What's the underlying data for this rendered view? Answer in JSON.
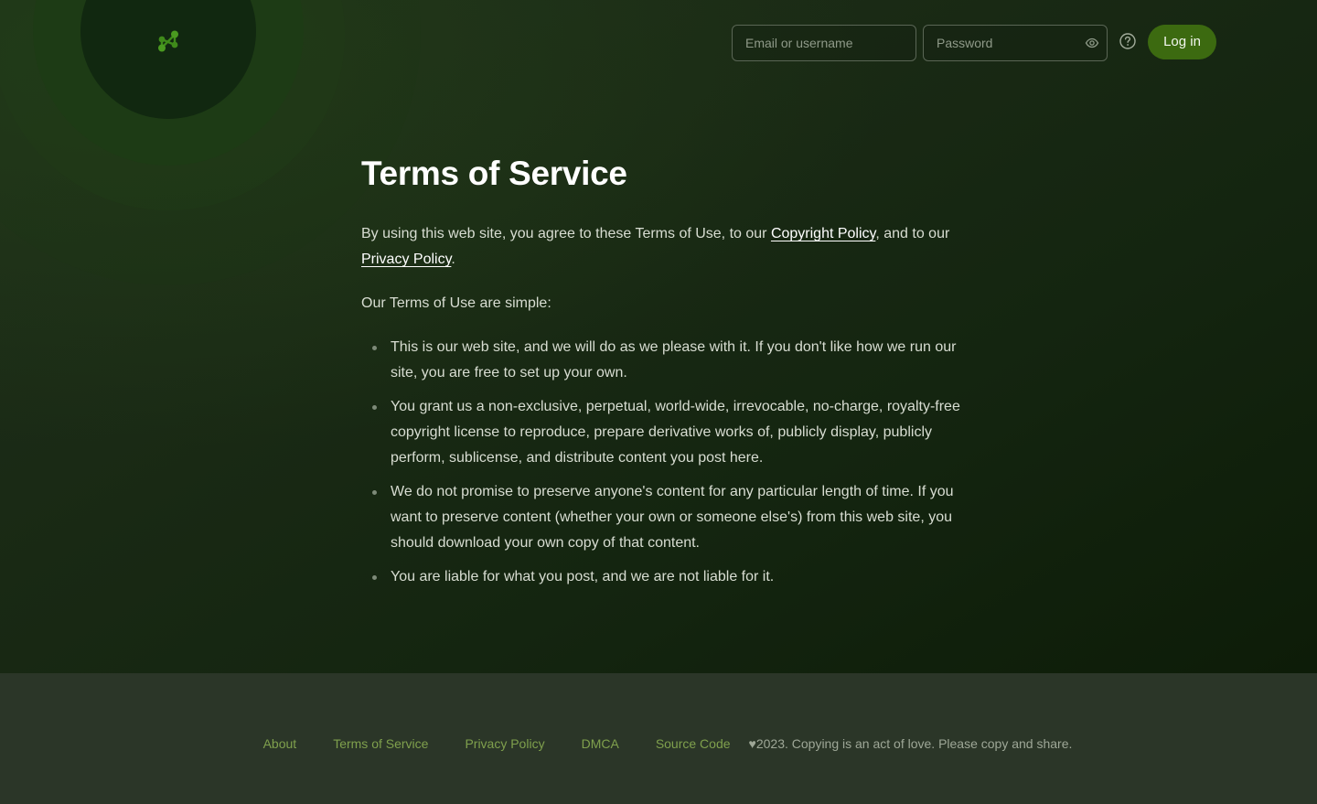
{
  "header": {
    "logo_icon": "network-nodes-icon",
    "email_placeholder": "Email or username",
    "password_placeholder": "Password",
    "show_password_icon": "eye-icon",
    "help_icon": "question-circle-icon",
    "login_label": "Log in"
  },
  "main": {
    "title": "Terms of Service",
    "intro": {
      "before_copyright": "By using this web site, you agree to these Terms of Use, to our ",
      "copyright_link": "Copyright Policy",
      "between": ", and to our ",
      "privacy_link": "Privacy Policy",
      "after": "."
    },
    "simple_line": "Our Terms of Use are simple:",
    "terms": [
      "This is our web site, and we will do as we please with it. If you don't like how we run our site, you are free to set up your own.",
      "You grant us a non-exclusive, perpetual, world-wide, irrevocable, no-charge, royalty-free copyright license to reproduce, prepare derivative works of, publicly display, publicly perform, sublicense, and distribute content you post here.",
      "We do not promise to preserve anyone's content for any particular length of time. If you want to preserve content (whether your own or someone else's) from this web site, you should download your own copy of that content.",
      "You are liable for what you post, and we are not liable for it."
    ]
  },
  "footer": {
    "links": [
      "About",
      "Terms of Service",
      "Privacy Policy",
      "DMCA",
      "Source Code"
    ],
    "copyright": "♥2023. Copying is an act of love. Please copy and share."
  },
  "colors": {
    "accent": "#3c6a10",
    "footer_link": "#7fa04d",
    "background": "#1a2a15",
    "footer_background": "#2b3628"
  }
}
